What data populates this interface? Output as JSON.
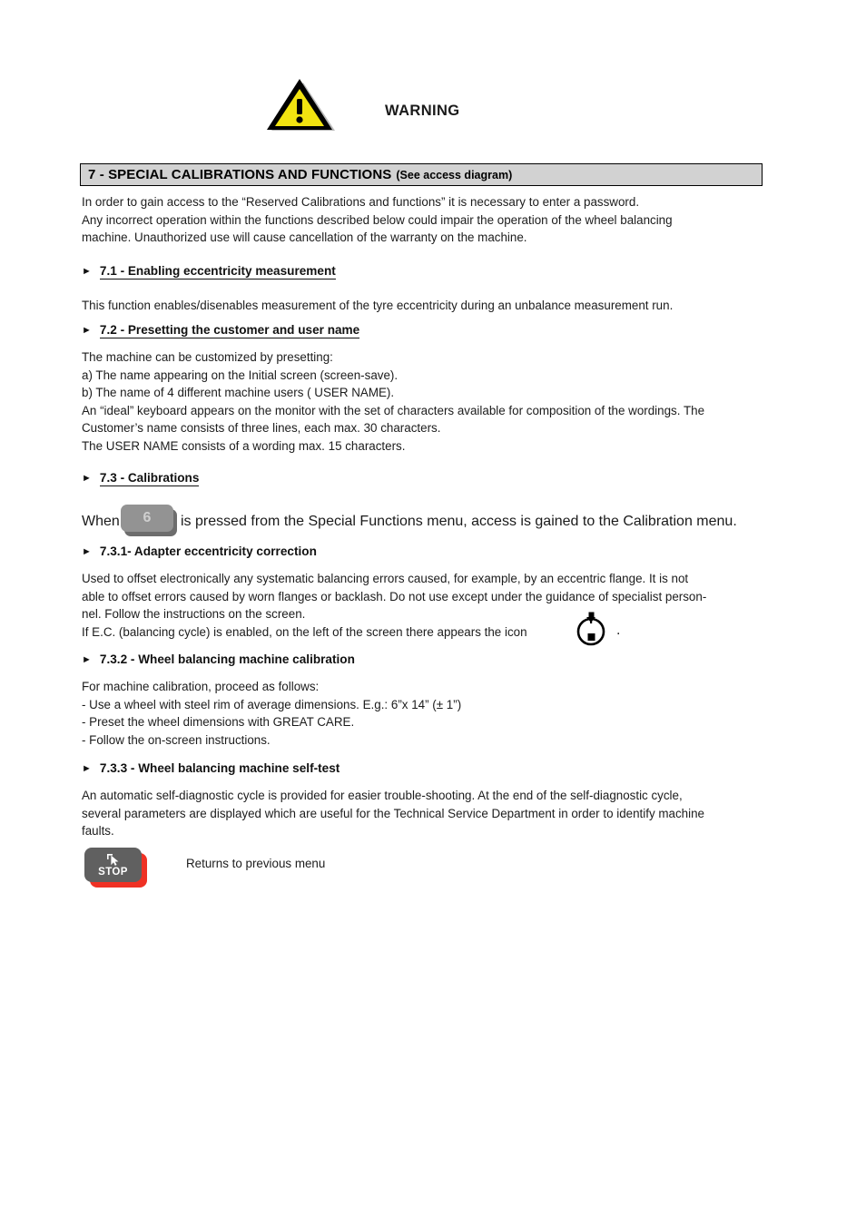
{
  "warning": {
    "icon": "warning-triangle-icon",
    "label": "WARNING"
  },
  "section_bar": {
    "title": "7 - SPECIAL CALIBRATIONS AND FUNCTIONS",
    "subtitle": "(See access diagram)",
    "background": "#d2d2d2",
    "border": "#000000"
  },
  "intro": {
    "line1": "In order to gain access to the “Reserved Calibrations and functions” it is necessary to enter a password.",
    "line2": "Any incorrect operation within the functions described below could impair the operation of the wheel balancing",
    "line3": "machine. Unauthorized use will cause cancellation of the warranty on the machine."
  },
  "sections": [
    {
      "bullet": "►",
      "heading": "7.1 - Enabling eccentricity measurement",
      "underlined": true,
      "lines": [
        "This function enables/disenables measurement of the tyre eccentricity during an unbalance measurement run."
      ]
    },
    {
      "bullet": "►",
      "heading": "7.2 - Presetting the customer and user name",
      "underlined": true,
      "lines": [
        "The machine can be customized by presetting:",
        "a) The name appearing on the Initial screen (screen-save).",
        "b) The name of 4 different machine users ( USER NAME).",
        "An “ideal” keyboard appears on the monitor with the set of characters available for composition of the wordings. The",
        "Customer’s name consists of three lines, each max. 30 characters.",
        "The USER NAME consists of a wording max. 15 characters."
      ]
    },
    {
      "bullet": "►",
      "heading": "7.3 - Calibrations",
      "underlined": true,
      "lines": []
    }
  ],
  "calibration_sentence": {
    "before": "When",
    "key_label": "6",
    "after": "is pressed from the Special Functions menu, access is gained to the Calibration menu."
  },
  "sub_sections": [
    {
      "bullet": "►",
      "heading": "7.3.1- Adapter eccentricity correction",
      "underlined": false,
      "lines": [
        "Used to offset electronically any systematic balancing errors caused, for example, by an eccentric flange. It is not",
        "able to offset errors caused by worn flanges or backlash. Do not use except under the guidance of specialist person-",
        "nel. Follow the instructions on the screen."
      ],
      "icon_line": {
        "before": "If E.C. (balancing cycle) is enabled, on the left of the screen there appears the icon",
        "icon": "eccentricity-flange-icon",
        "after": "."
      }
    },
    {
      "bullet": "►",
      "heading": "7.3.2 - Wheel balancing machine calibration",
      "underlined": false,
      "lines": [
        "For machine calibration, proceed as follows:",
        "- Use a wheel with steel rim of average dimensions. E.g.: 6”x 14” (± 1”)",
        "- Preset the wheel dimensions with GREAT CARE.",
        "- Follow the on-screen instructions."
      ]
    },
    {
      "bullet": "►",
      "heading": "7.3.3 - Wheel balancing machine self-test",
      "underlined": false,
      "lines": [
        "An automatic self-diagnostic cycle is provided for easier trouble-shooting. At the end of the self-diagnostic cycle,",
        "several parameters are displayed which are useful for the Technical Service Department in order to identify machine",
        "faults."
      ]
    }
  ],
  "stop_key": {
    "label": "STOP",
    "cursor_icon": "cursor-arrow-icon",
    "caption": "Returns to previous menu",
    "body_color": "#606060",
    "shadow_color": "#ef3124"
  }
}
